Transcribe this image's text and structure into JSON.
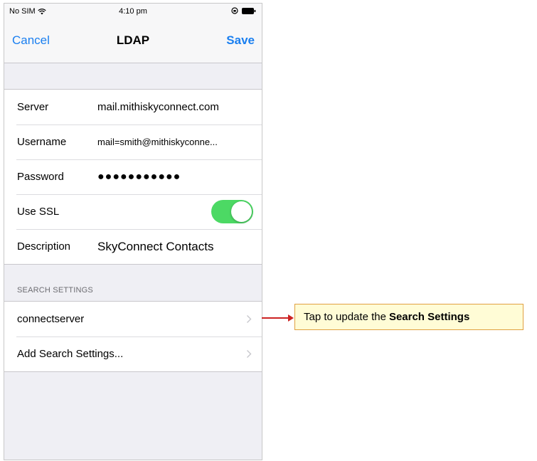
{
  "status_bar": {
    "carrier": "No SIM",
    "time": "4:10 pm",
    "icons": [
      "wifi-icon",
      "rotation-lock-icon",
      "battery-icon"
    ]
  },
  "nav": {
    "cancel_label": "Cancel",
    "title": "LDAP",
    "save_label": "Save"
  },
  "account": {
    "server_label": "Server",
    "server_value": "mail.mithiskyconnect.com",
    "username_label": "Username",
    "username_value": "mail=smith@mithiskyconne...",
    "password_label": "Password",
    "password_value": "●●●●●●●●●●●",
    "ssl_label": "Use SSL",
    "ssl_enabled": true,
    "description_label": "Description",
    "description_value": "SkyConnect Contacts"
  },
  "search": {
    "section_header": "SEARCH SETTINGS",
    "items": [
      {
        "label": "connectserver"
      },
      {
        "label": "Add Search Settings..."
      }
    ]
  },
  "callout": {
    "text_prefix": "Tap to update the",
    "text_bold": "Search Settings"
  },
  "colors": {
    "accent": "#1a7ff0",
    "toggle_on": "#4cd964",
    "callout_bg": "#fffcd6",
    "callout_border": "#e0a040",
    "arrow": "#cc2222"
  }
}
